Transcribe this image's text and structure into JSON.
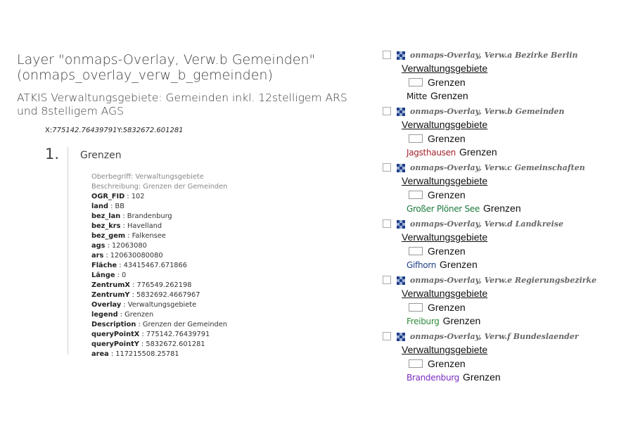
{
  "layer": {
    "title": "Layer \"onmaps-Overlay, Verw.b Gemeinden\" (onmaps_overlay_verw_b_gemeinden)",
    "description": "ATKIS Verwaltungsgebiete: Gemeinden inkl. 12stelligem ARS und 8stelligem AGS",
    "coord_x_label": "X:",
    "coord_x_value": "775142.76439791",
    "coord_y_label": "Y:",
    "coord_y_value": "5832672.601281"
  },
  "result": {
    "number": "1.",
    "title": "Grenzen",
    "oberbegriff": "Oberbegriff: Verwaltungsgebiete",
    "beschreibung": "Beschreibung: Grenzen der Gemeinden",
    "attributes": [
      {
        "key": "OGR_FID",
        "value": " : 102"
      },
      {
        "key": "land",
        "value": " : BB"
      },
      {
        "key": "bez_lan",
        "value": " : Brandenburg"
      },
      {
        "key": "bez_krs",
        "value": " : Havelland"
      },
      {
        "key": "bez_gem",
        "value": " : Falkensee"
      },
      {
        "key": "ags",
        "value": " : 12063080"
      },
      {
        "key": "ars",
        "value": " : 120630080080"
      },
      {
        "key": "Fläche",
        "value": " : 43415467.671866"
      },
      {
        "key": "Länge",
        "value": " : 0"
      },
      {
        "key": "ZentrumX",
        "value": " : 776549.262198"
      },
      {
        "key": "ZentrumY",
        "value": " : 5832692.4667967"
      },
      {
        "key": "Overlay",
        "value": " : Verwaltungsgebiete"
      },
      {
        "key": "legend",
        "value": " : Grenzen"
      },
      {
        "key": "Description",
        "value": " : Grenzen der Gemeinden"
      },
      {
        "key": "queryPointX",
        "value": " : 775142.76439791"
      },
      {
        "key": "queryPointY",
        "value": " : 5832672.601281"
      },
      {
        "key": "area",
        "value": " : 117215508.25781"
      }
    ]
  },
  "overlays": [
    {
      "title": "onmaps-Overlay, Verw.a Bezirke Berlin",
      "category": "Verwaltungsgebiete",
      "legend": "Grenzen",
      "place": "Mitte",
      "place_color": "#111111",
      "name_legend": "Grenzen"
    },
    {
      "title": "onmaps-Overlay, Verw.b Gemeinden",
      "category": "Verwaltungsgebiete",
      "legend": "Grenzen",
      "place": "Jagsthausen",
      "place_color": "#a3232e",
      "name_legend": "Grenzen"
    },
    {
      "title": "onmaps-Overlay, Verw.c Gemeinschaften",
      "category": "Verwaltungsgebiete",
      "legend": "Grenzen",
      "place": "Großer Plöner See",
      "place_color": "#1a7a3a",
      "name_legend": "Grenzen"
    },
    {
      "title": "onmaps-Overlay, Verw.d Landkreise",
      "category": "Verwaltungsgebiete",
      "legend": "Grenzen",
      "place": "Gifhorn",
      "place_color": "#1f3f8a",
      "name_legend": "Grenzen"
    },
    {
      "title": "onmaps-Overlay, Verw.e Regierungsbezirke",
      "category": "Verwaltungsgebiete",
      "legend": "Grenzen",
      "place": "Freiburg",
      "place_color": "#2e8a3a",
      "name_legend": "Grenzen"
    },
    {
      "title": "onmaps-Overlay, Verw.f Bundeslaender",
      "category": "Verwaltungsgebiete",
      "legend": "Grenzen",
      "place": "Brandenburg",
      "place_color": "#7a2ec0",
      "name_legend": "Grenzen"
    }
  ],
  "icons": {
    "overlay_icon": "layer-grid-icon",
    "checkbox": "checkbox-icon",
    "legend_swatch": "legend-swatch"
  }
}
